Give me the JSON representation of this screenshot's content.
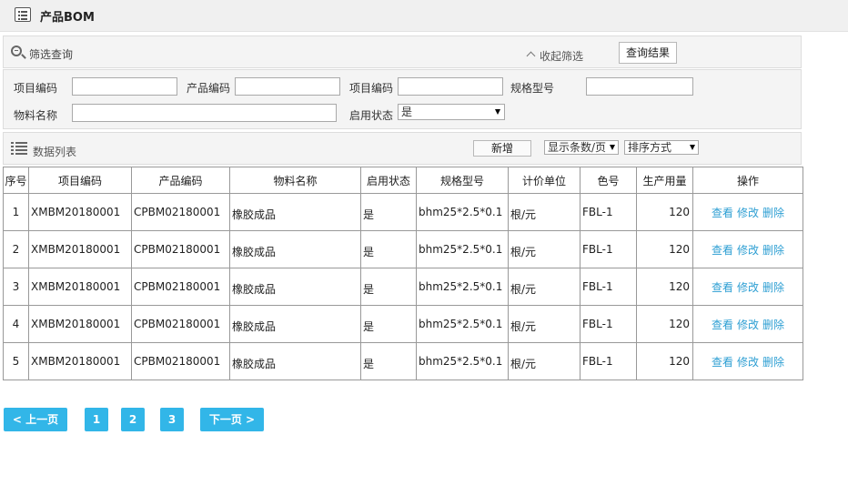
{
  "header": {
    "title": "产品BOM",
    "icon": "list-icon"
  },
  "filter": {
    "title": "筛选查询",
    "collapse_label": "收起筛选",
    "query_button": "查询结果"
  },
  "form": {
    "project_code_label": "项目编码",
    "product_code_label": "产品编码",
    "project_code2_label": "项目编码",
    "spec_label": "规格型号",
    "material_name_label": "物料名称",
    "status_label": "启用状态",
    "status_value": "是"
  },
  "datalist": {
    "title": "数据列表",
    "add_button": "新增",
    "page_size_select": "显示条数/页",
    "sort_select": "排序方式"
  },
  "table": {
    "headers": [
      "序号",
      "项目编码",
      "产品编码",
      "物料名称",
      "启用状态",
      "规格型号",
      "计价单位",
      "色号",
      "生产用量",
      "操作"
    ],
    "rows": [
      {
        "no": "1",
        "project_code": "XMBM20180001",
        "product_code": "CPBM02180001",
        "material": "橡胶成品",
        "status": "是",
        "spec": "bhm25*2.5*0.1",
        "unit": "根/元",
        "color": "FBL-1",
        "qty": "120"
      },
      {
        "no": "2",
        "project_code": "XMBM20180001",
        "product_code": "CPBM02180001",
        "material": "橡胶成品",
        "status": "是",
        "spec": "bhm25*2.5*0.1",
        "unit": "根/元",
        "color": "FBL-1",
        "qty": "120"
      },
      {
        "no": "3",
        "project_code": "XMBM20180001",
        "product_code": "CPBM02180001",
        "material": "橡胶成品",
        "status": "是",
        "spec": "bhm25*2.5*0.1",
        "unit": "根/元",
        "color": "FBL-1",
        "qty": "120"
      },
      {
        "no": "4",
        "project_code": "XMBM20180001",
        "product_code": "CPBM02180001",
        "material": "橡胶成品",
        "status": "是",
        "spec": "bhm25*2.5*0.1",
        "unit": "根/元",
        "color": "FBL-1",
        "qty": "120"
      },
      {
        "no": "5",
        "project_code": "XMBM20180001",
        "product_code": "CPBM02180001",
        "material": "橡胶成品",
        "status": "是",
        "spec": "bhm25*2.5*0.1",
        "unit": "根/元",
        "color": "FBL-1",
        "qty": "120"
      }
    ],
    "actions": {
      "view": "查看",
      "edit": "修改",
      "delete": "删除"
    },
    "link_color": "#2e9fd3"
  },
  "pagination": {
    "prev": "< 上一页",
    "pages": [
      "1",
      "2",
      "3"
    ],
    "next": "下一页 >",
    "color": "#32b6e8"
  }
}
